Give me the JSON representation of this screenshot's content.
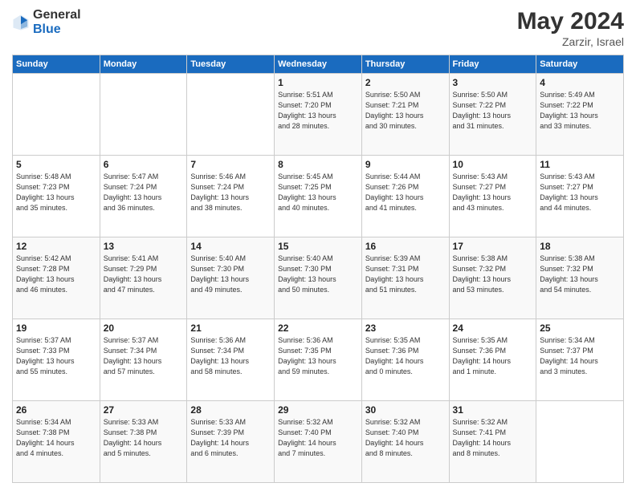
{
  "logo": {
    "general": "General",
    "blue": "Blue"
  },
  "title": "May 2024",
  "location": "Zarzir, Israel",
  "days_of_week": [
    "Sunday",
    "Monday",
    "Tuesday",
    "Wednesday",
    "Thursday",
    "Friday",
    "Saturday"
  ],
  "weeks": [
    [
      {
        "day": "",
        "info": ""
      },
      {
        "day": "",
        "info": ""
      },
      {
        "day": "",
        "info": ""
      },
      {
        "day": "1",
        "info": "Sunrise: 5:51 AM\nSunset: 7:20 PM\nDaylight: 13 hours\nand 28 minutes."
      },
      {
        "day": "2",
        "info": "Sunrise: 5:50 AM\nSunset: 7:21 PM\nDaylight: 13 hours\nand 30 minutes."
      },
      {
        "day": "3",
        "info": "Sunrise: 5:50 AM\nSunset: 7:22 PM\nDaylight: 13 hours\nand 31 minutes."
      },
      {
        "day": "4",
        "info": "Sunrise: 5:49 AM\nSunset: 7:22 PM\nDaylight: 13 hours\nand 33 minutes."
      }
    ],
    [
      {
        "day": "5",
        "info": "Sunrise: 5:48 AM\nSunset: 7:23 PM\nDaylight: 13 hours\nand 35 minutes."
      },
      {
        "day": "6",
        "info": "Sunrise: 5:47 AM\nSunset: 7:24 PM\nDaylight: 13 hours\nand 36 minutes."
      },
      {
        "day": "7",
        "info": "Sunrise: 5:46 AM\nSunset: 7:24 PM\nDaylight: 13 hours\nand 38 minutes."
      },
      {
        "day": "8",
        "info": "Sunrise: 5:45 AM\nSunset: 7:25 PM\nDaylight: 13 hours\nand 40 minutes."
      },
      {
        "day": "9",
        "info": "Sunrise: 5:44 AM\nSunset: 7:26 PM\nDaylight: 13 hours\nand 41 minutes."
      },
      {
        "day": "10",
        "info": "Sunrise: 5:43 AM\nSunset: 7:27 PM\nDaylight: 13 hours\nand 43 minutes."
      },
      {
        "day": "11",
        "info": "Sunrise: 5:43 AM\nSunset: 7:27 PM\nDaylight: 13 hours\nand 44 minutes."
      }
    ],
    [
      {
        "day": "12",
        "info": "Sunrise: 5:42 AM\nSunset: 7:28 PM\nDaylight: 13 hours\nand 46 minutes."
      },
      {
        "day": "13",
        "info": "Sunrise: 5:41 AM\nSunset: 7:29 PM\nDaylight: 13 hours\nand 47 minutes."
      },
      {
        "day": "14",
        "info": "Sunrise: 5:40 AM\nSunset: 7:30 PM\nDaylight: 13 hours\nand 49 minutes."
      },
      {
        "day": "15",
        "info": "Sunrise: 5:40 AM\nSunset: 7:30 PM\nDaylight: 13 hours\nand 50 minutes."
      },
      {
        "day": "16",
        "info": "Sunrise: 5:39 AM\nSunset: 7:31 PM\nDaylight: 13 hours\nand 51 minutes."
      },
      {
        "day": "17",
        "info": "Sunrise: 5:38 AM\nSunset: 7:32 PM\nDaylight: 13 hours\nand 53 minutes."
      },
      {
        "day": "18",
        "info": "Sunrise: 5:38 AM\nSunset: 7:32 PM\nDaylight: 13 hours\nand 54 minutes."
      }
    ],
    [
      {
        "day": "19",
        "info": "Sunrise: 5:37 AM\nSunset: 7:33 PM\nDaylight: 13 hours\nand 55 minutes."
      },
      {
        "day": "20",
        "info": "Sunrise: 5:37 AM\nSunset: 7:34 PM\nDaylight: 13 hours\nand 57 minutes."
      },
      {
        "day": "21",
        "info": "Sunrise: 5:36 AM\nSunset: 7:34 PM\nDaylight: 13 hours\nand 58 minutes."
      },
      {
        "day": "22",
        "info": "Sunrise: 5:36 AM\nSunset: 7:35 PM\nDaylight: 13 hours\nand 59 minutes."
      },
      {
        "day": "23",
        "info": "Sunrise: 5:35 AM\nSunset: 7:36 PM\nDaylight: 14 hours\nand 0 minutes."
      },
      {
        "day": "24",
        "info": "Sunrise: 5:35 AM\nSunset: 7:36 PM\nDaylight: 14 hours\nand 1 minute."
      },
      {
        "day": "25",
        "info": "Sunrise: 5:34 AM\nSunset: 7:37 PM\nDaylight: 14 hours\nand 3 minutes."
      }
    ],
    [
      {
        "day": "26",
        "info": "Sunrise: 5:34 AM\nSunset: 7:38 PM\nDaylight: 14 hours\nand 4 minutes."
      },
      {
        "day": "27",
        "info": "Sunrise: 5:33 AM\nSunset: 7:38 PM\nDaylight: 14 hours\nand 5 minutes."
      },
      {
        "day": "28",
        "info": "Sunrise: 5:33 AM\nSunset: 7:39 PM\nDaylight: 14 hours\nand 6 minutes."
      },
      {
        "day": "29",
        "info": "Sunrise: 5:32 AM\nSunset: 7:40 PM\nDaylight: 14 hours\nand 7 minutes."
      },
      {
        "day": "30",
        "info": "Sunrise: 5:32 AM\nSunset: 7:40 PM\nDaylight: 14 hours\nand 8 minutes."
      },
      {
        "day": "31",
        "info": "Sunrise: 5:32 AM\nSunset: 7:41 PM\nDaylight: 14 hours\nand 8 minutes."
      },
      {
        "day": "",
        "info": ""
      }
    ]
  ]
}
